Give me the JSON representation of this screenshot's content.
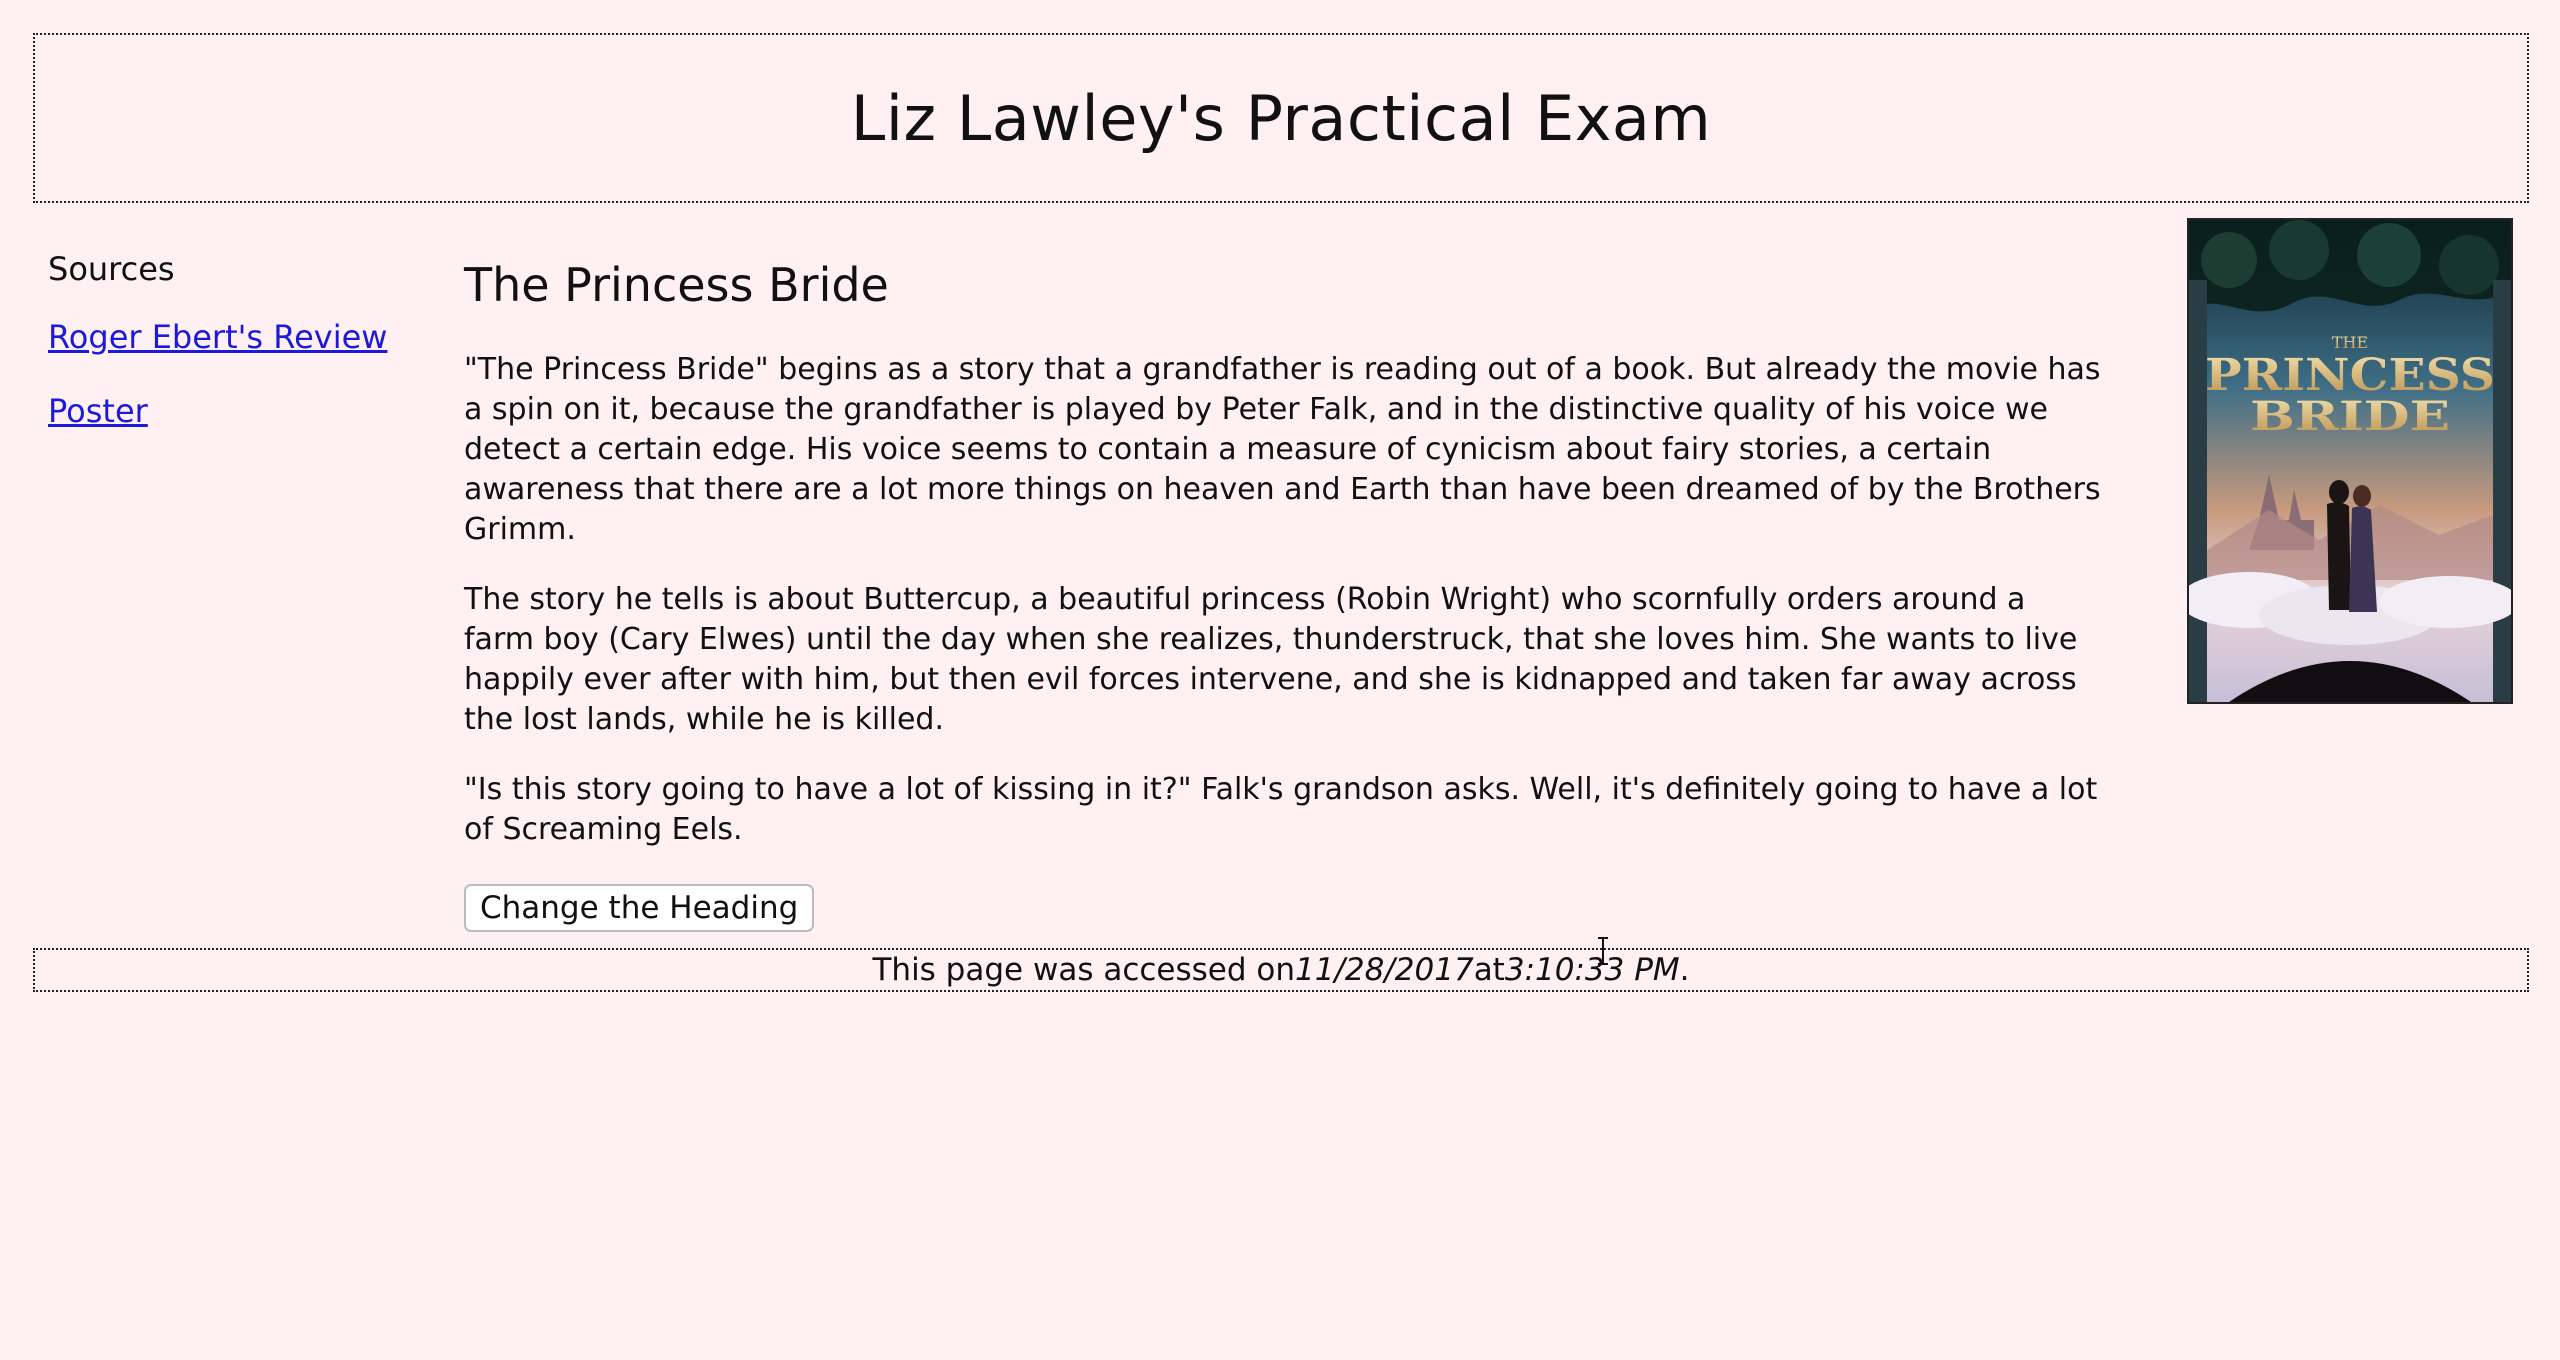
{
  "header": {
    "title": "Liz Lawley's Practical Exam"
  },
  "sidebar": {
    "title": "Sources",
    "links": [
      {
        "label": "Roger Ebert's Review"
      },
      {
        "label": "Poster"
      }
    ]
  },
  "main": {
    "heading": "The Princess Bride",
    "paragraphs": [
      "\"The Princess Bride\" begins as a story that a grandfather is reading out of a book. But already the movie has a spin on it, because the grandfather is played by Peter Falk, and in the distinctive quality of his voice we detect a certain edge. His voice seems to contain a measure of cynicism about fairy stories, a certain awareness that there are a lot more things on heaven and Earth than have been dreamed of by the Brothers Grimm.",
      "The story he tells is about Buttercup, a beautiful princess (Robin Wright) who scornfully orders around a farm boy (Cary Elwes) until the day when she realizes, thunderstruck, that she loves him. She wants to live happily ever after with him, but then evil forces intervene, and she is kidnapped and taken far away across the lost lands, while he is killed.",
      "\"Is this story going to have a lot of kissing in it?\" Falk's grandson asks. Well, it's definitely going to have a lot of Screaming Eels."
    ],
    "button_label": "Change the Heading"
  },
  "poster": {
    "title_line1": "THE",
    "title_line2": "PRINCESS",
    "title_line3": "BRIDE"
  },
  "footer": {
    "prefix": "This page was accessed on ",
    "date": "11/28/2017",
    "middle": " at ",
    "time": "3:10:33 PM",
    "suffix": "."
  },
  "colors": {
    "background": "#fff0f3",
    "link": "#1a1ad8"
  }
}
